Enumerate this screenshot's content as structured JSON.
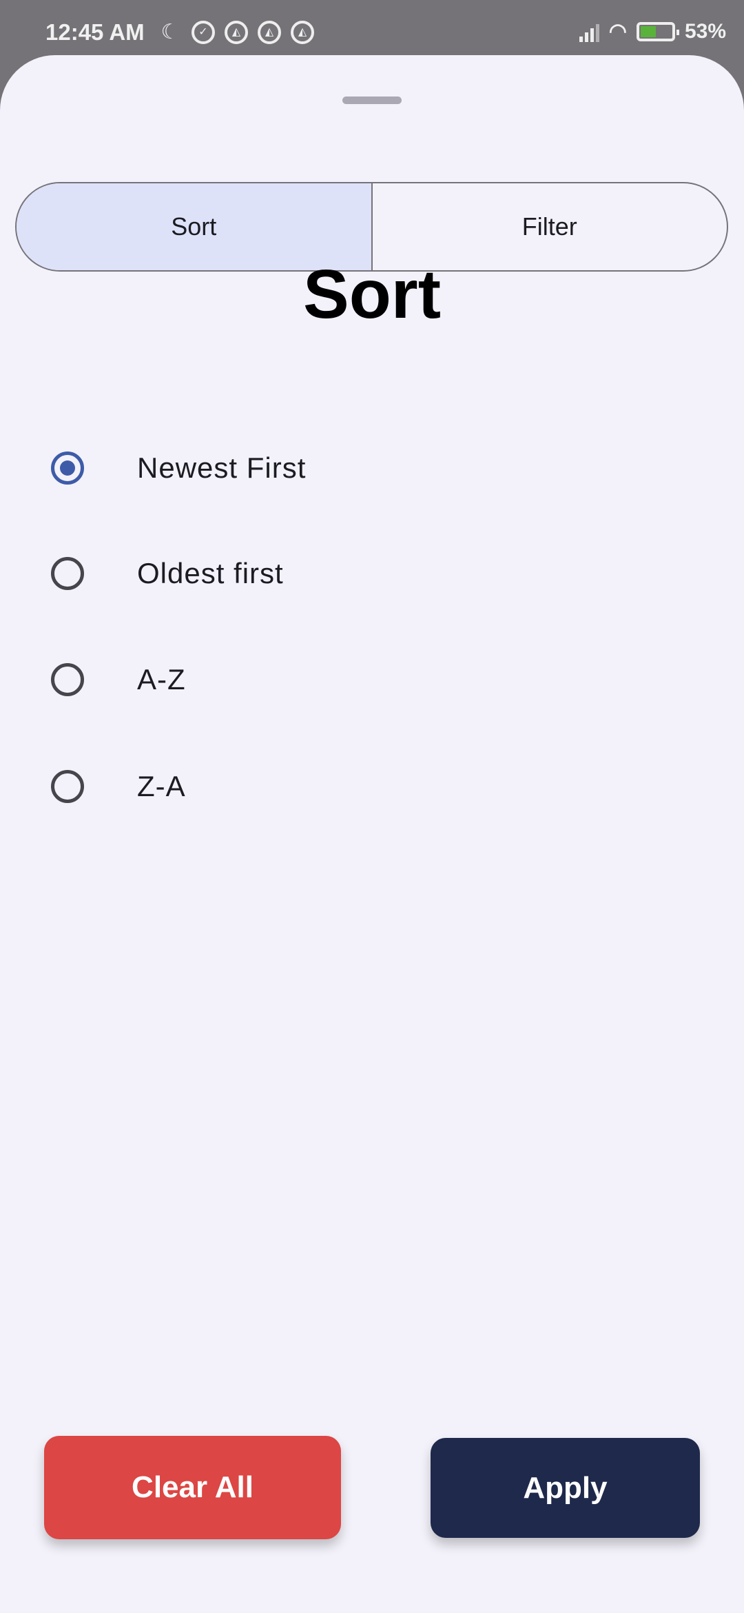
{
  "status_bar": {
    "time": "12:45 AM",
    "battery": "53%",
    "icons": [
      "moon-icon",
      "alarm-icon",
      "app-icon",
      "app-icon",
      "app-icon",
      "signal-icon",
      "wifi-icon",
      "battery-charging-icon"
    ]
  },
  "tabs": [
    {
      "label": "Sort",
      "selected": true
    },
    {
      "label": "Filter",
      "selected": false
    }
  ],
  "title": "Sort",
  "options": [
    {
      "label": "Newest First",
      "selected": true
    },
    {
      "label": "Oldest first",
      "selected": false
    },
    {
      "label": "A-Z",
      "selected": false
    },
    {
      "label": "Z-A",
      "selected": false
    }
  ],
  "buttons": {
    "clear": "Clear All",
    "apply": "Apply"
  },
  "colors": {
    "accent": "#3d5ba8",
    "clear": "#dc4644",
    "apply": "#1e294b",
    "tab_active": "#dde2f8"
  }
}
